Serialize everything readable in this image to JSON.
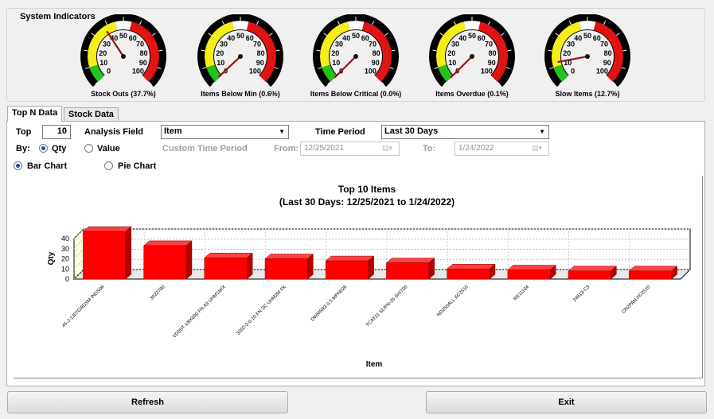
{
  "indicators": {
    "title": "System Indicators",
    "scale_labels": [
      "0",
      "10",
      "20",
      "30",
      "40",
      "50",
      "60",
      "70",
      "80",
      "90",
      "100"
    ],
    "gauges": [
      {
        "label": "Stock Outs (37.7%)",
        "value": 37.7
      },
      {
        "label": "Items Below Min (0.6%)",
        "value": 0.6
      },
      {
        "label": "Items Below Critical (0.0%)",
        "value": 0.0
      },
      {
        "label": "Items Overdue (0.1%)",
        "value": 0.1
      },
      {
        "label": "Slow Items (12.7%)",
        "value": 12.7
      }
    ],
    "colors": {
      "green": "#22c41c",
      "yellow": "#f5ee1a",
      "red": "#e01414",
      "needle": "#9b1010"
    }
  },
  "tabs": [
    {
      "label": "Top N Data",
      "active": true
    },
    {
      "label": "Stock Data",
      "active": false
    }
  ],
  "controls": {
    "top_label": "Top",
    "top_value": "10",
    "analysis_field_label": "Analysis Field",
    "analysis_field_value": "Item",
    "time_period_label": "Time Period",
    "time_period_value": "Last 30 Days",
    "by_label": "By:",
    "by_qty": "Qty",
    "by_value": "Value",
    "by_selected": "Qty",
    "custom_time_period_label": "Custom Time Period",
    "from_label": "From:",
    "from_value": "12/25/2021",
    "to_label": "To:",
    "to_value": "1/24/2022",
    "bar_chart": "Bar Chart",
    "pie_chart": "Pie Chart",
    "chart_selected": "Bar Chart"
  },
  "chart_data": {
    "type": "bar",
    "title": "Top 10 Items",
    "subtitle": "(Last 30 Days: 12/25/2021 to 1/24/2022)",
    "xlabel": "Item",
    "ylabel": "Qty",
    "ylim": [
      0,
      40
    ],
    "yticks": [
      0,
      10,
      20,
      30,
      40
    ],
    "categories": [
      "45-J-1207GRDSM INDS06",
      "3022780",
      "VD0ST 1/8X000 FN A3 UHM1M/X",
      "3202-2-0-10 FN SC UHM2M FK",
      "DWM5R3 0.5 MPN026",
      "TCAT21 SL/FN-25 SH/700",
      "ND250ALL XC2510",
      "RE11104",
      "24613-C3",
      "CN2PAN XC2510"
    ],
    "values": [
      47,
      33,
      21,
      20,
      18,
      16,
      10,
      9,
      8,
      8
    ],
    "bar_color": "#ff0000",
    "grid": true,
    "legend": "none"
  },
  "buttons": {
    "refresh": "Refresh",
    "exit": "Exit"
  }
}
